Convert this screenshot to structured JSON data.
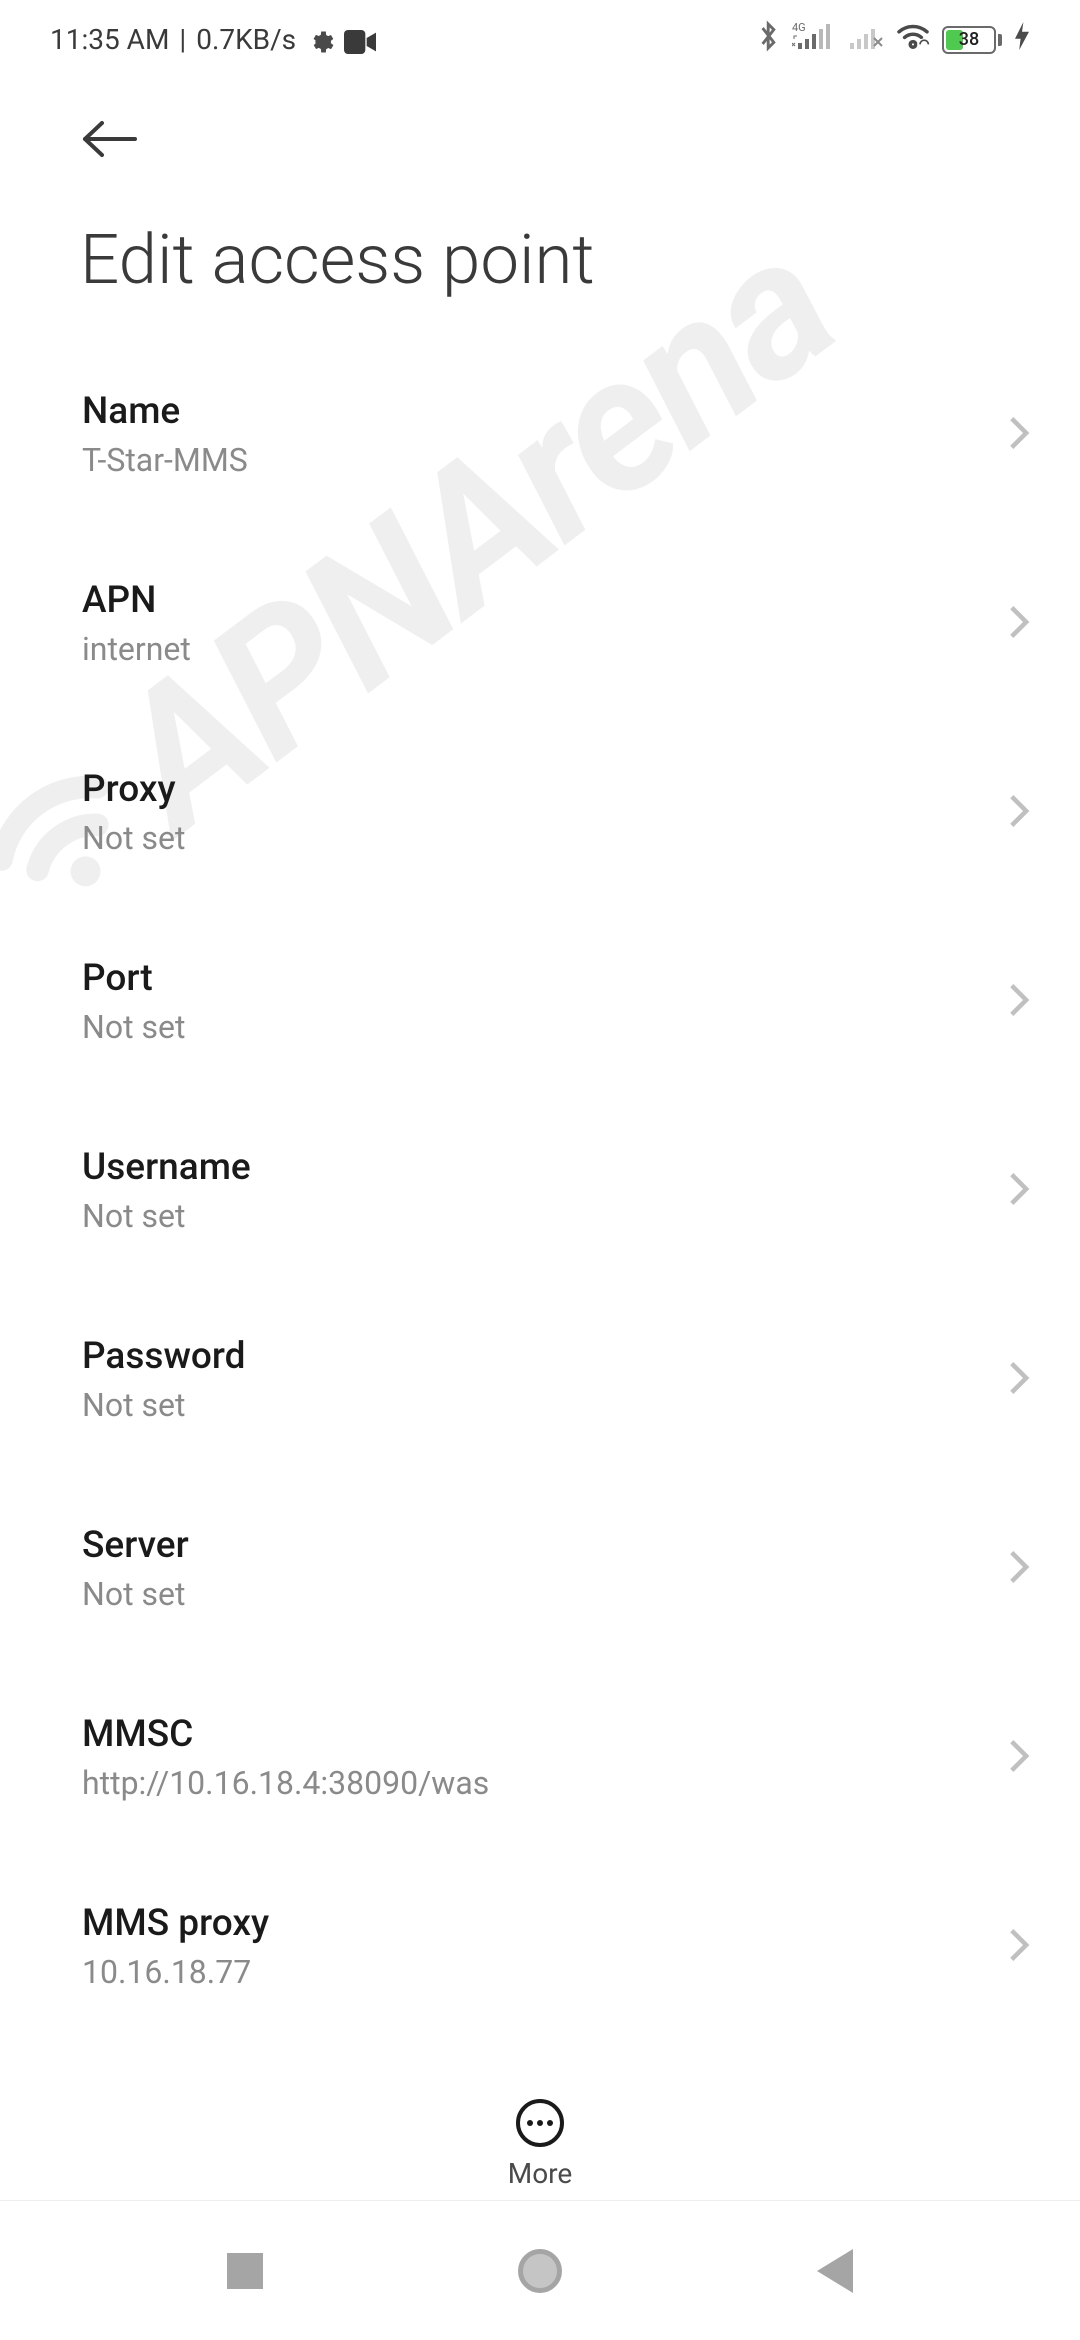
{
  "status": {
    "time": "11:35 AM",
    "network_speed": "0.7KB/s",
    "network_type": "4G",
    "battery_percent": "38"
  },
  "header": {
    "title": "Edit access point"
  },
  "settings": [
    {
      "label": "Name",
      "value": "T-Star-MMS"
    },
    {
      "label": "APN",
      "value": "internet"
    },
    {
      "label": "Proxy",
      "value": "Not set"
    },
    {
      "label": "Port",
      "value": "Not set"
    },
    {
      "label": "Username",
      "value": "Not set"
    },
    {
      "label": "Password",
      "value": "Not set"
    },
    {
      "label": "Server",
      "value": "Not set"
    },
    {
      "label": "MMSC",
      "value": "http://10.16.18.4:38090/was"
    },
    {
      "label": "MMS proxy",
      "value": "10.16.18.77"
    }
  ],
  "more": {
    "label": "More"
  },
  "watermark": {
    "text": "APNArena"
  }
}
